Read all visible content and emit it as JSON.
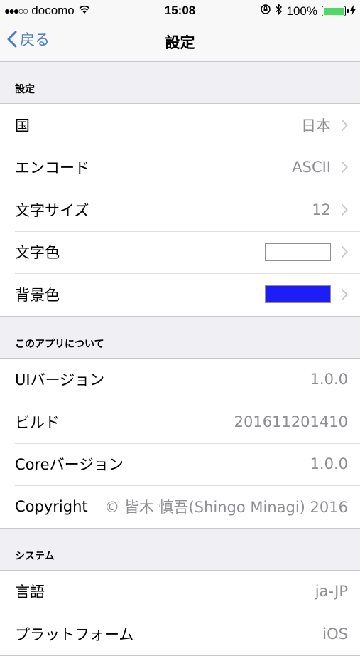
{
  "status": {
    "carrier": "docomo",
    "time": "15:08",
    "battery": "100%"
  },
  "nav": {
    "back_label": "戻る",
    "title": "設定"
  },
  "sections": [
    {
      "header": "設定",
      "rows": [
        {
          "label": "国",
          "value": "日本"
        },
        {
          "label": "エンコード",
          "value": "ASCII"
        },
        {
          "label": "文字サイズ",
          "value": "12"
        },
        {
          "label": "文字色",
          "color": "#ffffff"
        },
        {
          "label": "背景色",
          "color": "#1d1df5"
        }
      ]
    },
    {
      "header": "このアプリについて",
      "rows": [
        {
          "label": "UIバージョン",
          "value": "1.0.0"
        },
        {
          "label": "ビルド",
          "value": "201611201410"
        },
        {
          "label": "Coreバージョン",
          "value": "1.0.0"
        },
        {
          "label": "Copyright",
          "value": "© 皆木 慎吾(Shingo Minagi) 2016"
        }
      ]
    },
    {
      "header": "システム",
      "rows": [
        {
          "label": "言語",
          "value": "ja-JP"
        },
        {
          "label": "プラットフォーム",
          "value": "iOS"
        }
      ]
    }
  ]
}
